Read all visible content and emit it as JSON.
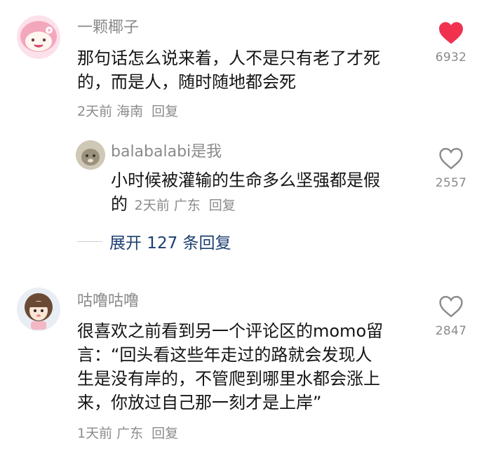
{
  "comments": [
    {
      "username": "一颗椰子",
      "text_lines": [
        "那句话怎么说来着，人不是只有老了才死",
        "的，而是人，随时随地都会死"
      ],
      "time": "2天前",
      "location": "海南",
      "reply_label": "回复",
      "like_count": "6932",
      "liked": true
    },
    {
      "username": "balabalabi是我",
      "text_lines": [
        "小时候被灌输的生命多么坚强都是假"
      ],
      "tail_text": "的",
      "time": "2天前",
      "location": "广东",
      "reply_label": "回复",
      "like_count": "2557",
      "liked": false
    },
    {
      "username": "咕噜咕噜",
      "text_lines": [
        "很喜欢之前看到另一个评论区的momo留",
        "言：“回头看这些年走过的路就会发现人",
        "生是没有岸的，不管爬到哪里水都会涨上",
        "来，你放过自己那一刻才是上岸”"
      ],
      "time": "1天前",
      "location": "广东",
      "reply_label": "回复",
      "like_count": "2847",
      "liked": false
    }
  ],
  "expand_replies_label": "展开 127 条回复",
  "colors": {
    "liked_heart": "#f0324f",
    "muted_text": "#8a8a8a",
    "expand_link": "#1c3f70"
  },
  "icons": {
    "like_filled": "heart-filled-icon",
    "like_outline": "heart-outline-icon"
  }
}
